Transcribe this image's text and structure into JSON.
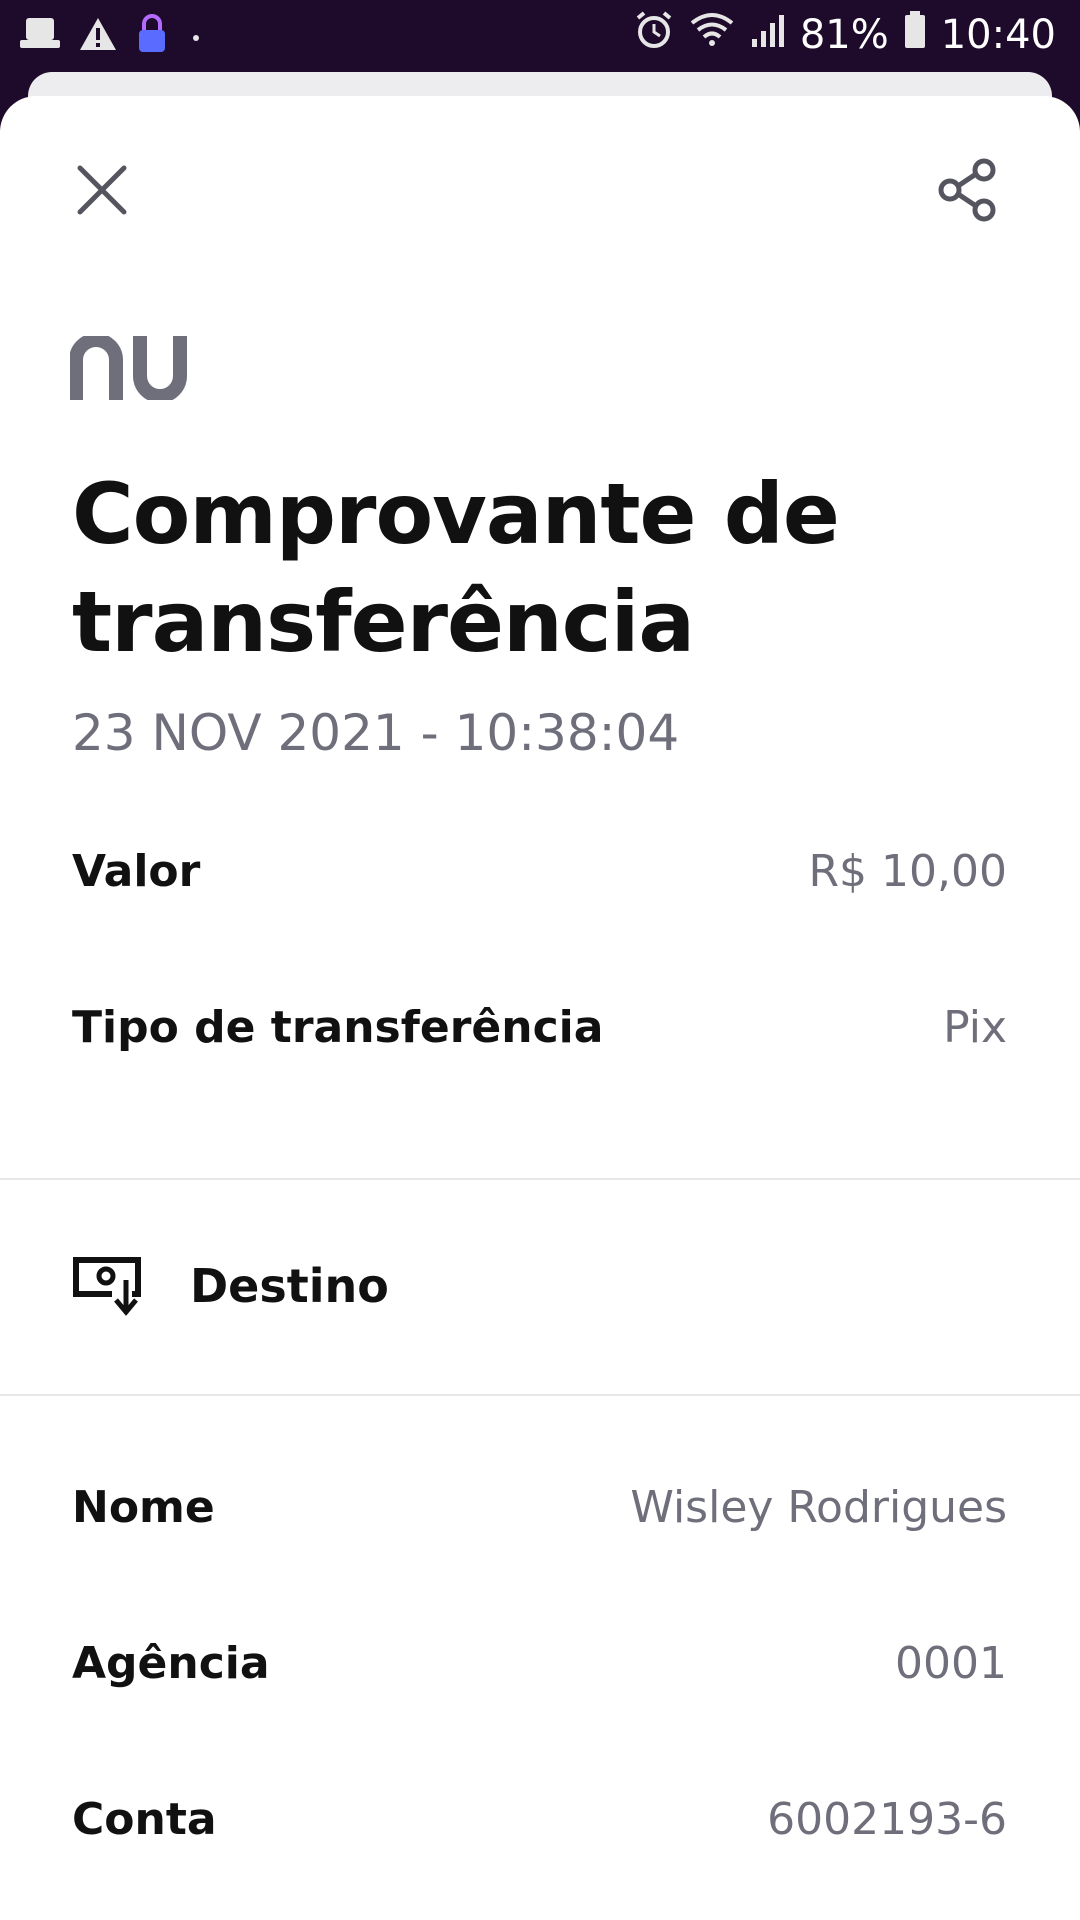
{
  "status_bar": {
    "battery_percent": "81%",
    "time": "10:40"
  },
  "header": {
    "close_icon": "close-icon",
    "share_icon": "share-icon"
  },
  "logo": {
    "text": "nu",
    "color": "#6f6f7b"
  },
  "receipt": {
    "title": "Comprovante de transferência",
    "datetime": "23 NOV 2021 - 10:38:04",
    "details": [
      {
        "label": "Valor",
        "value": "R$ 10,00"
      },
      {
        "label": "Tipo de transferência",
        "value": "Pix"
      }
    ]
  },
  "destination": {
    "icon": "transfer-in-icon",
    "title": "Destino",
    "fields": [
      {
        "label": "Nome",
        "value": "Wisley Rodrigues"
      },
      {
        "label": "Agência",
        "value": "0001"
      },
      {
        "label": "Conta",
        "value": "6002193-6"
      }
    ]
  },
  "colors": {
    "status_bar_bg": "#1e0a2a",
    "text_primary": "#111111",
    "text_secondary": "#6f6f7b",
    "divider": "#e7e7ea"
  }
}
